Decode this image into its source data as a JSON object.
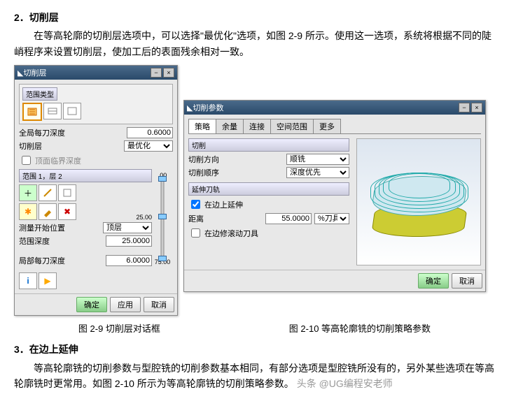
{
  "section2": {
    "num": "2．",
    "title": "切削层"
  },
  "para1": "在等高轮廓的切削层选项中，可以选择\"最优化\"选项，如图 2-9 所示。使用这一选项，系统将根据不同的陡峭程序来设置切削层，使加工后的表面残余相对一致。",
  "dlg1": {
    "title": "切削层",
    "range_type": "范围类型",
    "global_depth": "全局每刀深度",
    "global_depth_val": "0.6000",
    "cut_layer": "切削层",
    "cut_layer_val": "最优化",
    "top_crit": "顶面临界深度",
    "range_hdr": "范围 1，层 2",
    "meas_start": "测量开始位置",
    "meas_start_val": "顶层",
    "range_depth": "范围深度",
    "range_depth_val": "25.0000",
    "local_depth": "局部每刀深度",
    "local_depth_val": "6.0000",
    "slider_top": ".00",
    "slider_mid": "25.00",
    "slider_bot": "75.00",
    "ok": "确定",
    "apply": "应用",
    "cancel": "取消"
  },
  "dlg2": {
    "title": "切削参数",
    "tabs": [
      "策略",
      "余量",
      "连接",
      "空间范围",
      "更多"
    ],
    "cut_hdr": "切削",
    "cut_dir": "切削方向",
    "cut_dir_val": "顺铣",
    "cut_order": "切削顺序",
    "cut_order_val": "深度优先",
    "ext_hdr": "延伸刀轨",
    "ext_edge": "在边上延伸",
    "dist": "距离",
    "dist_val": "55.0000",
    "dist_unit": "%刀具",
    "roll_edge": "在边修滚动刀具",
    "ok": "确定",
    "cancel": "取消"
  },
  "cap1": "图 2-9  切削层对话框",
  "cap2": "图 2-10  等高轮廓铣的切削策略参数",
  "section3": {
    "num": "3．",
    "title": "在边上延伸"
  },
  "para2": "等高轮廓铣的切削参数与型腔铣的切削参数基本相同，有部分选项是型腔铣所没有的，另外某些选项在等高轮廓铣时更常用。如图 2-10 所示为等高轮廓铣的切削策略参数。",
  "watermark": "头条 @UG编程安老师"
}
